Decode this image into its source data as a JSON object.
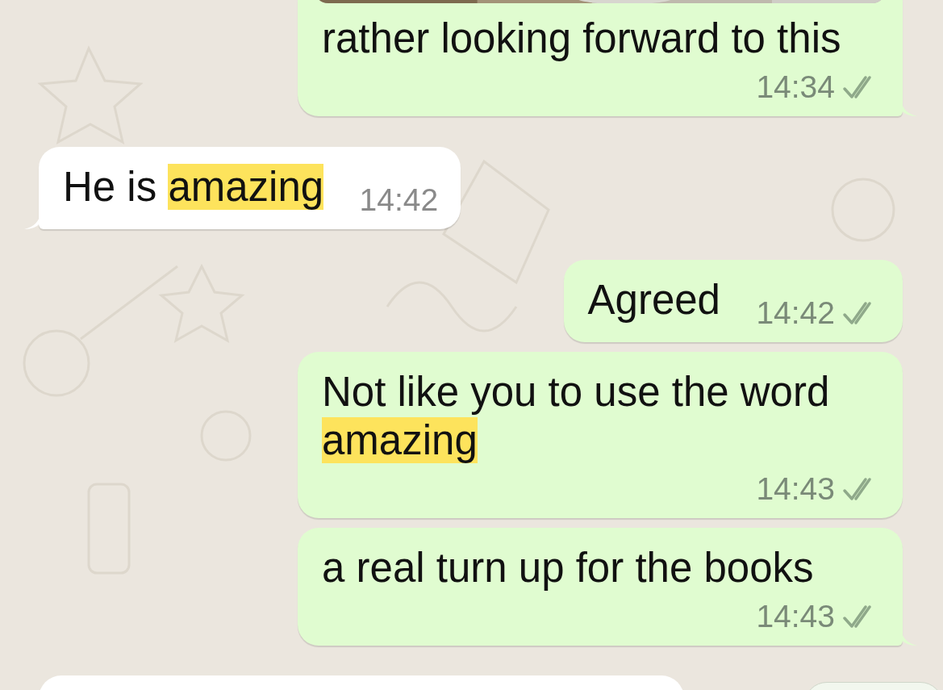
{
  "messages": [
    {
      "kind": "outgoing",
      "picture": {
        "kind": "picture"
      },
      "tail": true,
      "parts": [
        {
          "text": "rather looking forward to this",
          "highlighted": false
        }
      ],
      "time": "14:34"
    },
    {
      "kind": "incoming",
      "tail": true,
      "parts": [
        {
          "text": "He is ",
          "highlighted": false
        },
        {
          "text": "amazing",
          "highlighted": true
        }
      ],
      "time": "14:42"
    },
    {
      "kind": "outgoing",
      "tail": false,
      "parts": [
        {
          "text": "Agreed",
          "highlighted": false
        }
      ],
      "time": "14:42"
    },
    {
      "kind": "outgoing",
      "tail": false,
      "parts": [
        {
          "text": "Not like you to use the word ",
          "highlighted": false
        },
        {
          "text": "amazing",
          "highlighted": true
        }
      ],
      "time": "14:43"
    },
    {
      "kind": "outgoing",
      "tail": true,
      "parts": [
        {
          "text": "a real turn up for the books",
          "highlighted": false
        }
      ],
      "time": "14:43"
    }
  ],
  "partial_bubbles": [
    {
      "kind": "incoming"
    },
    {
      "kind": "outgoing"
    }
  ]
}
